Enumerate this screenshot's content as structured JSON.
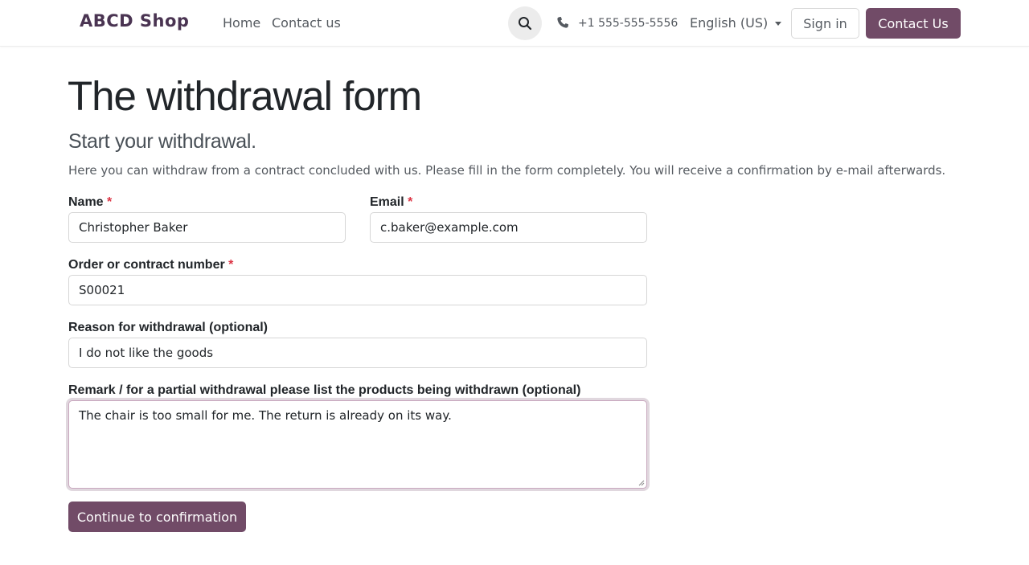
{
  "header": {
    "brand": "ABCD Shop",
    "nav": [
      {
        "label": "Home"
      },
      {
        "label": "Contact us"
      }
    ],
    "search_icon": "search-icon",
    "phone_icon": "phone-icon",
    "phone": "+1 555-555-5556",
    "language": "English (US)",
    "sign_in": "Sign in",
    "contact_button": "Contact Us"
  },
  "main": {
    "title": "The withdrawal form",
    "subtitle": "Start your withdrawal.",
    "intro": "Here you can withdraw from a contract concluded with us. Please fill in the form completely. You will receive a confirmation by e-mail afterwards."
  },
  "form": {
    "required_marker": "*",
    "name": {
      "label": "Name",
      "value": "Christopher Baker"
    },
    "email": {
      "label": "Email",
      "value": "c.baker@example.com"
    },
    "order": {
      "label": "Order or contract number",
      "value": "S00021"
    },
    "reason": {
      "label": "Reason for withdrawal (optional)",
      "value": "I do not like the goods"
    },
    "remark": {
      "label": "Remark / for a partial withdrawal please list the products being withdrawn (optional)",
      "value": "The chair is too small for me. The return is already on its way."
    },
    "submit": "Continue to confirmation"
  },
  "colors": {
    "brand": "#714b67",
    "required": "#dc3545"
  }
}
